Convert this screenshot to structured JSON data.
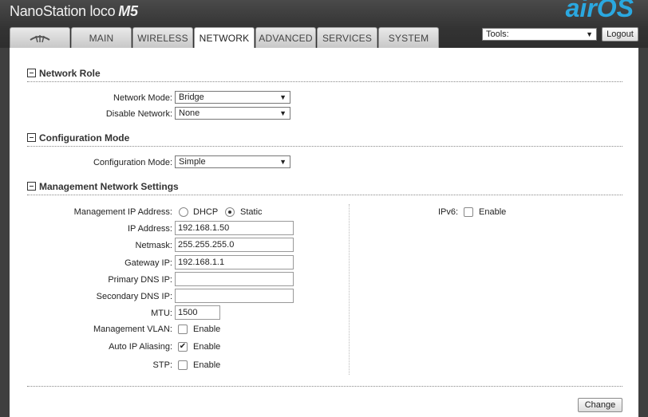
{
  "brand": {
    "product": "NanoStation loco",
    "model": "M5",
    "os_logo": "airOS"
  },
  "tabs": [
    {
      "label": "",
      "icon": "ubiquiti-logo-icon"
    },
    {
      "label": "MAIN"
    },
    {
      "label": "WIRELESS"
    },
    {
      "label": "NETWORK",
      "active": true
    },
    {
      "label": "ADVANCED"
    },
    {
      "label": "SERVICES"
    },
    {
      "label": "SYSTEM"
    }
  ],
  "tools": {
    "label": "Tools:",
    "logout": "Logout"
  },
  "network_role": {
    "title": "Network Role",
    "network_mode_label": "Network Mode:",
    "network_mode_value": "Bridge",
    "disable_network_label": "Disable Network:",
    "disable_network_value": "None"
  },
  "configuration_mode": {
    "title": "Configuration Mode",
    "label": "Configuration Mode:",
    "value": "Simple"
  },
  "management": {
    "title": "Management Network Settings",
    "ip_mode_label": "Management IP Address:",
    "dhcp_label": "DHCP",
    "static_label": "Static",
    "ip_label": "IP Address:",
    "ip_value": "192.168.1.50",
    "netmask_label": "Netmask:",
    "netmask_value": "255.255.255.0",
    "gateway_label": "Gateway IP:",
    "gateway_value": "192.168.1.1",
    "primary_dns_label": "Primary DNS IP:",
    "primary_dns_value": "",
    "secondary_dns_label": "Secondary DNS IP:",
    "secondary_dns_value": "",
    "mtu_label": "MTU:",
    "mtu_value": "1500",
    "vlan_label": "Management VLAN:",
    "alias_label": "Auto IP Aliasing:",
    "stp_label": "STP:",
    "enable_label": "Enable",
    "ipv6_label": "IPv6:"
  },
  "change_button": "Change",
  "colors": {
    "accent": "#2aa8e0",
    "background": "#3f3f3f"
  }
}
